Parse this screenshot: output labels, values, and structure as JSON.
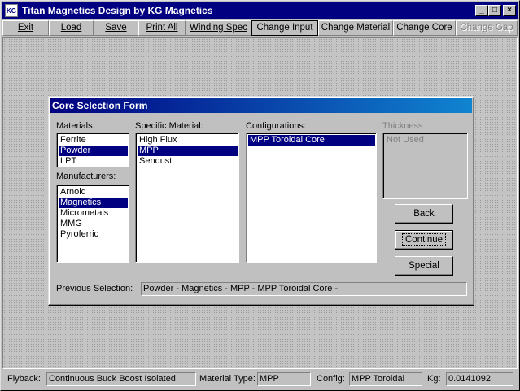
{
  "window": {
    "icon_text": "KG",
    "title": "Titan Magnetics Design by KG Magnetics",
    "controls": {
      "minimize": "_",
      "maximize": "□",
      "close": "×"
    }
  },
  "menu": {
    "exit": "Exit",
    "load": "Load",
    "save": "Save",
    "print_all": "Print All",
    "winding_spec": "Winding Spec",
    "change_input": "Change Input",
    "change_material": "Change Material",
    "change_core": "Change Core",
    "change_gap": "Change Gap"
  },
  "dialog": {
    "title": "Core Selection Form",
    "materials_label": "Materials:",
    "materials": [
      "Ferrite",
      "Powder",
      "LPT"
    ],
    "manufacturers_label": "Manufacturers:",
    "manufacturers": [
      "Arnold",
      "Magnetics",
      "Micrometals",
      "MMG",
      "Pyroferric"
    ],
    "specific_label": "Specific Material:",
    "specific": [
      "High Flux",
      "MPP",
      "Sendust"
    ],
    "config_label": "Configurations:",
    "configurations": [
      "MPP Toroidal Core"
    ],
    "thickness_label": "Thickness",
    "thickness": [
      "Not Used"
    ],
    "buttons": {
      "back": "Back",
      "continue": "Continue",
      "special": "Special"
    },
    "prev_label": "Previous Selection:",
    "prev_value": "Powder - Magnetics - MPP - MPP Toroidal Core -"
  },
  "status": {
    "flyback_label": "Flyback:",
    "flyback_value": "Continuous Buck Boost Isolated",
    "material_label": "Material Type:",
    "material_value": "MPP",
    "config_label": "Config:",
    "config_value": "MPP Toroidal",
    "kg_label": "Kg:",
    "kg_value": "0.0141092"
  }
}
